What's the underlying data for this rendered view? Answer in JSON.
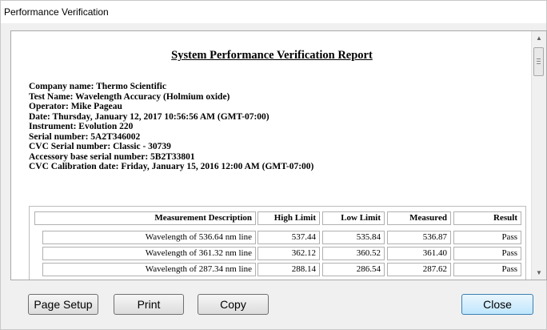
{
  "window": {
    "title": "Performance Verification"
  },
  "report": {
    "title": "System Performance Verification Report",
    "info": [
      "Company name: Thermo Scientific",
      "Test Name: Wavelength Accuracy (Holmium oxide)",
      "Operator: Mike Pageau",
      "Date: Thursday, January 12, 2017 10:56:56 AM (GMT-07:00)",
      "Instrument: Evolution 220",
      "Serial number: 5A2T346002",
      "CVC Serial number: Classic - 30739",
      "Accessory base serial number: 5B2T33801",
      "CVC Calibration date: Friday, January 15, 2016 12:00 AM (GMT-07:00)"
    ],
    "table": {
      "headers": [
        "Measurement Description",
        "High Limit",
        "Low Limit",
        "Measured",
        "Result"
      ],
      "rows": [
        [
          "Wavelength of 536.64 nm line",
          "537.44",
          "535.84",
          "536.87",
          "Pass"
        ],
        [
          "Wavelength of 361.32 nm line",
          "362.12",
          "360.52",
          "361.40",
          "Pass"
        ],
        [
          "Wavelength of 287.34 nm line",
          "288.14",
          "286.54",
          "287.62",
          "Pass"
        ]
      ]
    }
  },
  "buttons": {
    "page_setup": "Page Setup",
    "print": "Print",
    "copy": "Copy",
    "close": "Close"
  },
  "icons": {
    "scroll_up": "scroll-up-arrow-icon",
    "scroll_down": "scroll-down-arrow-icon"
  }
}
